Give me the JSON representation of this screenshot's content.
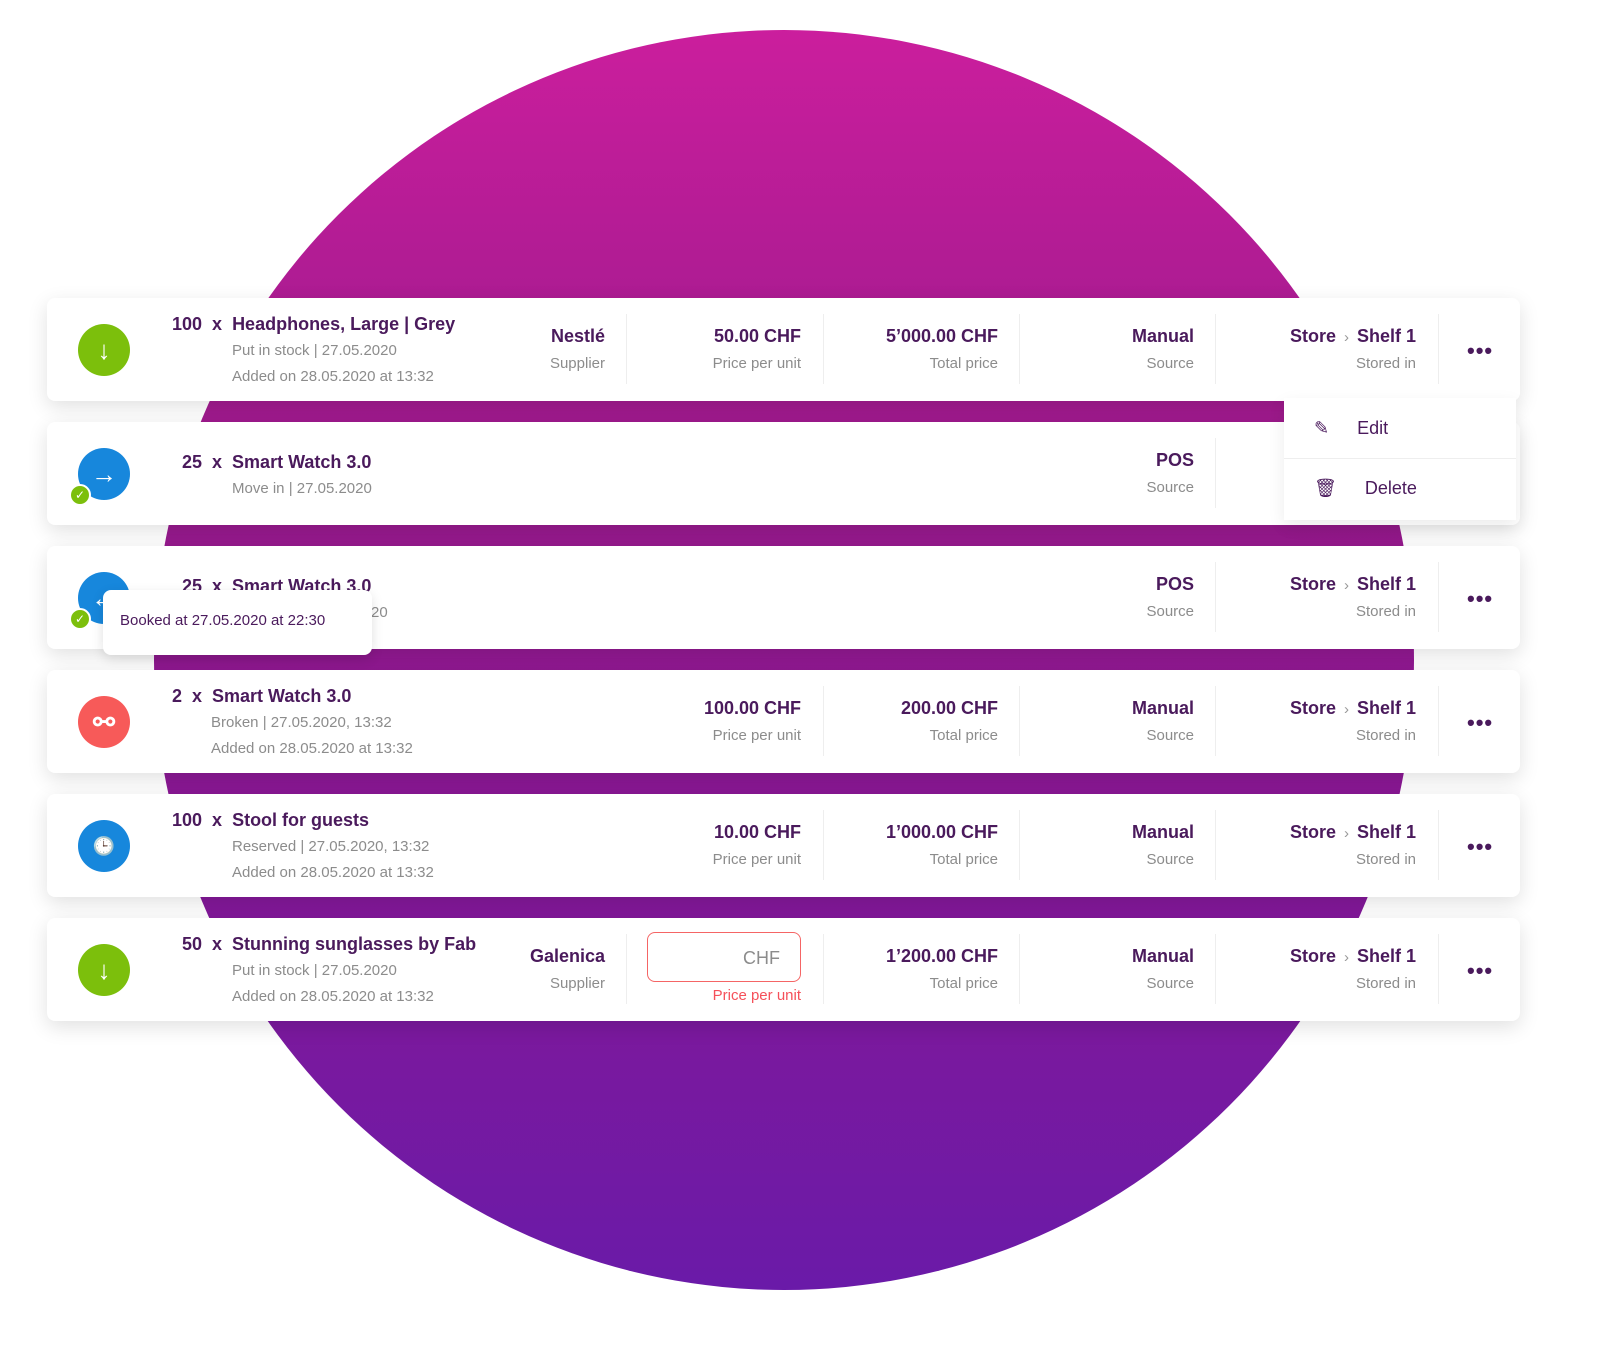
{
  "colors": {
    "accent": "#4a1a5c",
    "green": "#7cbf0c",
    "blue": "#1787dc",
    "red": "#f75a59",
    "error": "#f5505a"
  },
  "labels": {
    "x": "x",
    "supplier": "Supplier",
    "ppu": "Price per unit",
    "total": "Total price",
    "source": "Source",
    "stored": "Stored in",
    "store": "Store",
    "shelf": "Shelf 1",
    "more": "•••"
  },
  "rows": [
    {
      "qty": "100",
      "name": "Headphones, Large | Grey",
      "line1": "Put in stock | 27.05.2020",
      "line2": "Added on 28.05.2020 at 13:32",
      "icon": "arrow-down-icon",
      "supplier": "Nestlé",
      "ppu": "50.00 CHF",
      "total": "5’000.00 CHF",
      "source": "Manual"
    },
    {
      "qty": "25",
      "name": "Smart Watch 3.0",
      "line1": "Move in | 27.05.2020",
      "icon": "arrow-right-icon",
      "source": "POS"
    },
    {
      "qty": "25",
      "name": "Smart Watch 3.0",
      "line1": "20",
      "icon": "arrow-left-icon",
      "source": "POS"
    },
    {
      "qty": "2",
      "name": "Smart Watch 3.0",
      "line1": "Broken | 27.05.2020, 13:32",
      "line2": "Added on 28.05.2020 at 13:32",
      "icon": "broken-link-icon",
      "ppu": "100.00 CHF",
      "total": "200.00 CHF",
      "source": "Manual"
    },
    {
      "qty": "100",
      "name": "Stool for guests",
      "line1": "Reserved | 27.05.2020, 13:32",
      "line2": "Added on 28.05.2020 at 13:32",
      "icon": "reserved-icon",
      "ppu": "10.00 CHF",
      "total": "1’000.00 CHF",
      "source": "Manual"
    },
    {
      "qty": "50",
      "name": "Stunning sunglasses by Fab",
      "line1": "Put in stock | 27.05.2020",
      "line2": "Added on 28.05.2020 at 13:32",
      "icon": "arrow-down-icon",
      "supplier": "Galenica",
      "ppu_placeholder": "CHF",
      "total": "1’200.00 CHF",
      "source": "Manual"
    }
  ],
  "menu": {
    "edit": "Edit",
    "delete": "Delete"
  },
  "tooltip": "Booked at 27.05.2020 at 22:30"
}
